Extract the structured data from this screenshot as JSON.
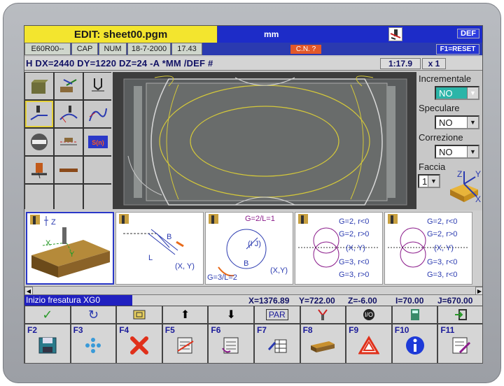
{
  "header": {
    "title": "EDIT: sheet00.pgm",
    "units": "mm",
    "def_button": "DEF"
  },
  "status_boxes": [
    "E60R00--",
    "CAP",
    "NUM",
    "18-7-2000",
    "17.43"
  ],
  "cn_badge": "C.N. ?",
  "f1_reset": "F1=RESET",
  "command_line": "H DX=2440 DY=1220 DZ=24 -A *MM /DEF #",
  "scale": "1:17.9",
  "multiplier": "x 1",
  "right_panel": {
    "incrementale_label": "Incrementale",
    "incrementale_value": "NO",
    "speculare_label": "Speculare",
    "speculare_value": "NO",
    "correzione_label": "Correzione",
    "correzione_value": "NO",
    "faccia_label": "Faccia",
    "faccia_value": "1",
    "axes": {
      "z": "Z",
      "y": "Y",
      "x": "X"
    }
  },
  "cards": {
    "c1": {
      "z": "Z",
      "x": "X",
      "y": "Y"
    },
    "c2": {
      "b": "B",
      "l": "L",
      "xy": "(X, Y)"
    },
    "c3": {
      "top": "G=2/L=1",
      "ij": "(I J)",
      "b": "B",
      "xy": "(X,Y)",
      "bottom": "G=3/L=2"
    },
    "c4": {
      "l1": "G=2, r<0",
      "l2": "G=2, r>0",
      "l3": "(X, Y)",
      "l4": "G=3, r<0",
      "l5": "G=3, r>0"
    },
    "c5": {
      "l1": "G=2, r<0",
      "l2": "G=2, r>0",
      "l3": "(X, Y)",
      "l4": "G=3, r<0",
      "l5": "G=3, r<0"
    }
  },
  "status": {
    "message": "Inizio fresatura XG0",
    "x": "X=1376.89",
    "y": "Y=722.00",
    "z": "Z=-6.00",
    "i": "I=70.00",
    "j": "J=670.00"
  },
  "softkeys_top": [
    "check-icon",
    "refresh-icon",
    "page-icon",
    "arrow-up-icon",
    "arrow-down-icon",
    "PAR",
    "tool-icon",
    "I/O",
    "calculator-icon",
    "exit-icon"
  ],
  "par_label": "PAR",
  "io_label": "I/O",
  "fkeys": [
    "F2",
    "F3",
    "F4",
    "F5",
    "F6",
    "F7",
    "F8",
    "F9",
    "F10",
    "F11"
  ]
}
